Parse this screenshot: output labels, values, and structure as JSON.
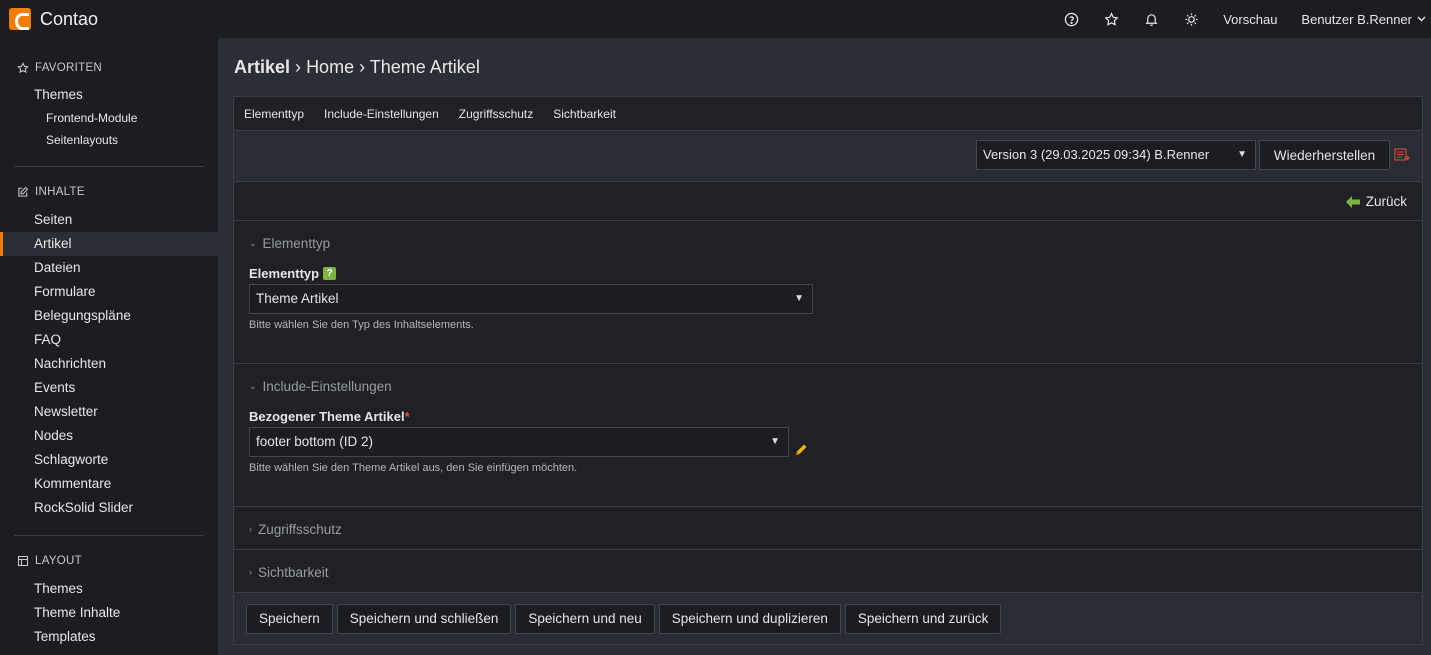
{
  "topbar": {
    "brand": "Contao",
    "preview": "Vorschau",
    "user": "Benutzer B.Renner"
  },
  "sidebar": {
    "sections": [
      {
        "title": "Favoriten",
        "icon": "star-icon"
      },
      {
        "title": "Inhalte",
        "icon": "edit-icon"
      },
      {
        "title": "Layout",
        "icon": "layout-icon"
      }
    ],
    "favorites": [
      "Themes",
      "Frontend-Module",
      "Seitenlayouts"
    ],
    "content": [
      "Seiten",
      "Artikel",
      "Dateien",
      "Formulare",
      "Belegungspläne",
      "FAQ",
      "Nachrichten",
      "Events",
      "Newsletter",
      "Nodes",
      "Schlagworte",
      "Kommentare",
      "RockSolid Slider"
    ],
    "layout": [
      "Themes",
      "Theme Inhalte",
      "Templates"
    ],
    "active": "Artikel"
  },
  "breadcrumb": {
    "root": "Artikel",
    "sep1": "›",
    "page": "Home",
    "sep2": "›",
    "current": "Theme Artikel"
  },
  "tabs": [
    "Elementtyp",
    "Include-Einstellungen",
    "Zugriffsschutz",
    "Sichtbarkeit"
  ],
  "version": {
    "selected": "Version 3 (29.03.2025 09:34) B.Renner",
    "restore_label": "Wiederherstellen"
  },
  "back_label": "Zurück",
  "fieldsets": {
    "elementtyp": {
      "legend": "Elementtyp",
      "label": "Elementtyp",
      "help": "?",
      "value": "Theme Artikel",
      "hint": "Bitte wählen Sie den Typ des Inhaltselements."
    },
    "include": {
      "legend": "Include-Einstellungen",
      "label": "Bezogener Theme Artikel",
      "required": "*",
      "value": "footer bottom (ID 2)",
      "hint": "Bitte wählen Sie den Theme Artikel aus, den Sie einfügen möchten."
    },
    "zugriff": {
      "legend": "Zugriffsschutz"
    },
    "sichtbarkeit": {
      "legend": "Sichtbarkeit"
    }
  },
  "buttons": {
    "save": "Speichern",
    "save_close": "Speichern und schließen",
    "save_new": "Speichern und neu",
    "save_duplicate": "Speichern und duplizieren",
    "save_back": "Speichern und zurück"
  },
  "colors": {
    "accent": "#f47c00",
    "help": "#7cb342",
    "required": "#e74c3c"
  }
}
